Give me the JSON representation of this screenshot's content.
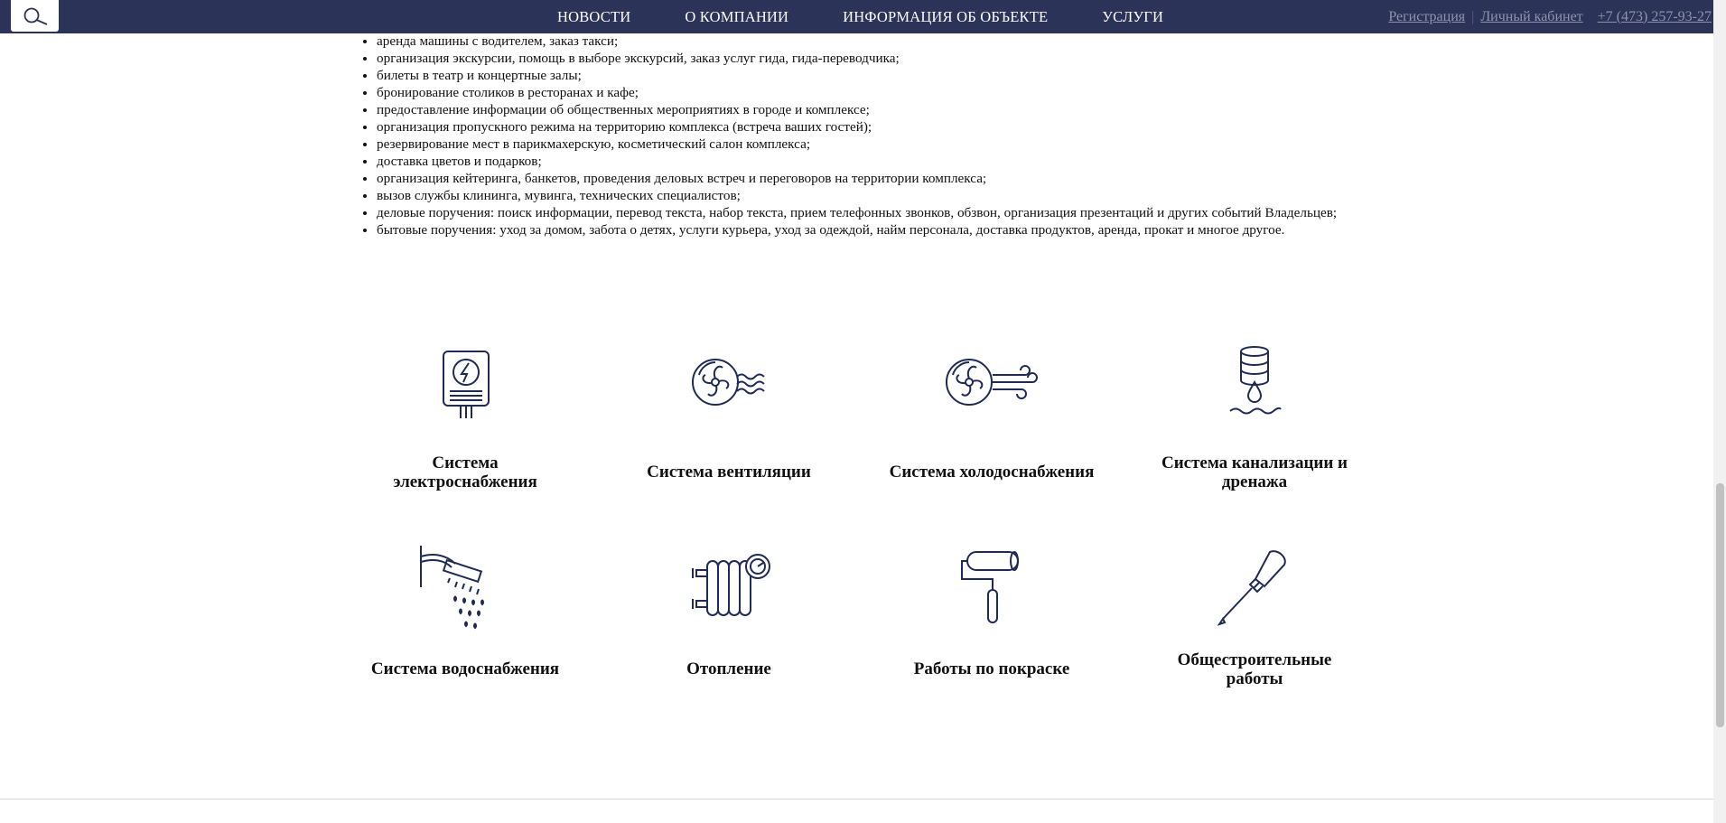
{
  "nav": {
    "items": [
      {
        "label": "НОВОСТИ"
      },
      {
        "label": "О КОМПАНИИ"
      },
      {
        "label": "ИНФОРМАЦИЯ ОБ ОБЪЕКТЕ"
      },
      {
        "label": "УСЛУГИ"
      }
    ]
  },
  "auth": {
    "register": "Регистрация",
    "cabinet": "Личный кабинет",
    "phone": "+7 (473) 257-93-27",
    "separator": "|"
  },
  "services": [
    "аренда машины с водителем, заказ такси;",
    "организация экскурсии, помощь в выборе экскурсий, заказ услуг гида, гида-переводчика;",
    "билеты в театр и концертные залы;",
    "бронирование столиков в ресторанах и кафе;",
    "предоставление информации об общественных мероприятиях в городе и комплексе;",
    "организация пропускного режима на территорию комплекса (встреча ваших гостей);",
    "резервирование мест в парикмахерскую, косметический салон комплекса;",
    "доставка цветов и подарков;",
    "организация кейтеринга, банкетов, проведения деловых встреч и переговоров на территории комплекса;",
    "вызов службы клининга, мувинга, технических специалистов;",
    "деловые поручения: поиск информации, перевод текста, набор текста, прием телефонных звонков, обзвон, организация презентаций и других событий Владельцев;",
    "бытовые поручения: уход за домом, забота о детях, услуги курьера, уход за одеждой, найм персонала, доставка продуктов, аренда, прокат и многое другое."
  ],
  "systems": [
    {
      "title": "Система электроснабжения",
      "icon": "electric-panel-icon"
    },
    {
      "title": "Система вентиляции",
      "icon": "ventilation-fan-icon"
    },
    {
      "title": "Система холодоснабжения",
      "icon": "cooling-fan-icon"
    },
    {
      "title": "Система канализации и дренажа",
      "icon": "drainage-drop-icon"
    },
    {
      "title": "Система водоснабжения",
      "icon": "shower-icon"
    },
    {
      "title": "Отопление",
      "icon": "radiator-icon"
    },
    {
      "title": "Работы по покраске",
      "icon": "paint-roller-icon"
    },
    {
      "title": "Общестроительные работы",
      "icon": "screwdriver-icon"
    }
  ],
  "colors": {
    "navbar": "#2c3358",
    "icon_stroke": "#1f2a55"
  },
  "icons": {
    "search": "search-icon"
  }
}
